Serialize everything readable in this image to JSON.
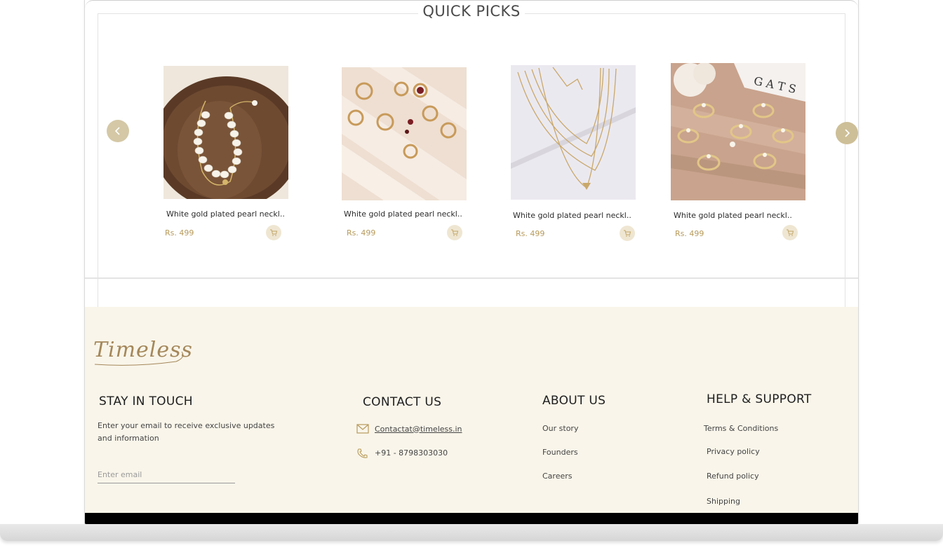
{
  "section_title": "QUICK PICKS",
  "nav": {
    "prev_icon": "chevron-left-icon",
    "next_icon": "chevron-right-icon"
  },
  "products": [
    {
      "name": "White gold plated pearl neckl..",
      "price": "Rs. 499",
      "image": "pearl-bracelet-on-wooden-plate"
    },
    {
      "name": "White gold plated pearl neckl..",
      "price": "Rs. 499",
      "image": "gold-rings-on-striped-cloth"
    },
    {
      "name": "White gold plated pearl neckl..",
      "price": "Rs. 499",
      "image": "layered-gold-chain-necklace"
    },
    {
      "name": "White gold plated pearl neckl..",
      "price": "Rs. 499",
      "image": "gold-rings-on-wooden-table"
    }
  ],
  "footer": {
    "logo": "Timeless",
    "stay_in_touch": {
      "heading": "STAY IN TOUCH",
      "line1": "Enter your email to receive exclusive updates",
      "line2": "and information",
      "email_placeholder": "Enter email"
    },
    "contact_us": {
      "heading": "CONTACT US",
      "email": "Contactat@timeless.in",
      "phone": "+91 - 8798303030"
    },
    "about_us": {
      "heading": "ABOUT US",
      "links": [
        "Our story",
        "Founders",
        "Careers"
      ]
    },
    "help_support": {
      "heading": "HELP & SUPPORT",
      "links": [
        "Terms & Conditions",
        "Privacy policy",
        "Refund policy",
        "Shipping"
      ]
    }
  },
  "colors": {
    "accent_gold": "#b79a5b",
    "arrow_bg": "#cdbf97",
    "footer_bg": "#f9f5ea"
  }
}
